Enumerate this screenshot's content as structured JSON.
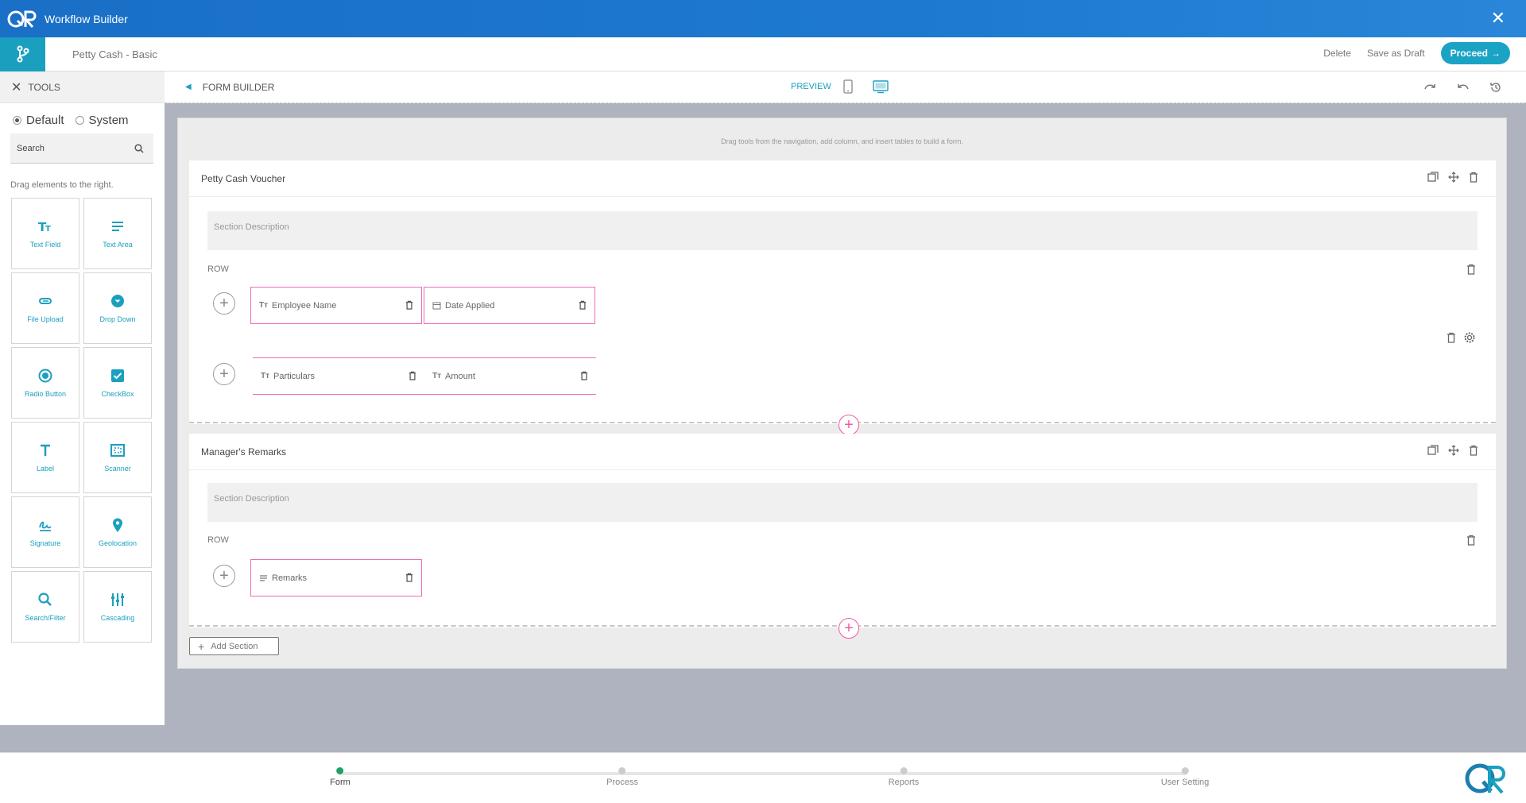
{
  "app": {
    "title": "Workflow Builder",
    "close_icon": "close-icon"
  },
  "topbar": {
    "form_name": "Petty Cash - Basic",
    "delete_label": "Delete",
    "draft_label": "Save as Draft",
    "proceed_label": "Proceed"
  },
  "sidebar": {
    "header": "TOOLS",
    "radio_default": "Default",
    "radio_system": "System",
    "search_placeholder": "Search",
    "hint": "Drag elements to the right.",
    "tools": [
      {
        "label": "Text Field",
        "icon": "text-field-icon"
      },
      {
        "label": "Text Area",
        "icon": "text-area-icon"
      },
      {
        "label": "File Upload",
        "icon": "paperclip-icon"
      },
      {
        "label": "Drop Down",
        "icon": "dropdown-icon"
      },
      {
        "label": "Radio Button",
        "icon": "radio-icon"
      },
      {
        "label": "CheckBox",
        "icon": "checkbox-icon"
      },
      {
        "label": "Label",
        "icon": "label-icon"
      },
      {
        "label": "Scanner",
        "icon": "scanner-icon"
      },
      {
        "label": "Signature",
        "icon": "signature-icon"
      },
      {
        "label": "Geolocation",
        "icon": "location-pin-icon"
      },
      {
        "label": "Search/Filter",
        "icon": "search-icon"
      },
      {
        "label": "Cascading",
        "icon": "cascading-icon"
      }
    ]
  },
  "builder": {
    "title": "FORM BUILDER",
    "preview": "PREVIEW",
    "tip": "Drag tools from the navigation, add column, and insert tables to build a form.",
    "sections": [
      {
        "title": "Petty Cash Voucher",
        "description_placeholder": "Section Description",
        "row_label": "ROW",
        "fields_row1": [
          "Employee Name",
          "Date Applied"
        ],
        "fields_row2": [
          "Particulars",
          "Amount"
        ]
      },
      {
        "title": "Manager's Remarks",
        "description_placeholder": "Section Description",
        "row_label": "ROW",
        "fields_row1": [
          "Remarks"
        ]
      }
    ],
    "add_section": "Add Section"
  },
  "footer": {
    "steps": [
      "Form",
      "Process",
      "Reports",
      "User Setting"
    ],
    "active_step": "Form"
  },
  "colors": {
    "accent": "#1b9fbf",
    "pink": "#ef5aa8",
    "titlebar": "#1a6fc6",
    "active_step": "#1ea06b"
  }
}
